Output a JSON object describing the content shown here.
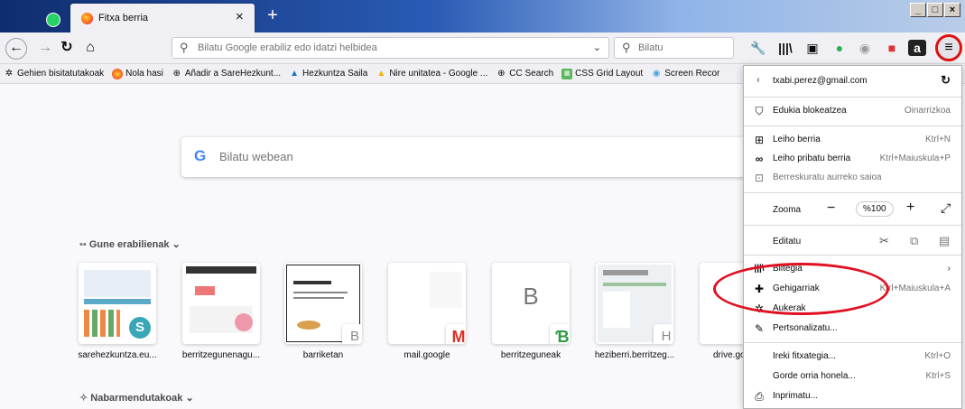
{
  "tabs": {
    "active_title": "Fitxa berria",
    "close_glyph": "×",
    "new_tab_glyph": "+"
  },
  "window_controls": [
    "_",
    "□",
    "×"
  ],
  "nav": {
    "url_placeholder": "Bilatu Google erabiliz edo idatzi helbidea",
    "search_placeholder": "Bilatu"
  },
  "bookmarks": [
    {
      "label": "Gehien bisitatutakoak",
      "icon": "gear-icon",
      "color": "#444"
    },
    {
      "label": "Nola hasi",
      "icon": "firefox-icon",
      "color": "#ff7a1a"
    },
    {
      "label": "Añadir a SareHezkunt...",
      "icon": "globe-icon",
      "color": "#555"
    },
    {
      "label": "Hezkuntza Saila",
      "icon": "hezkuntza-icon",
      "color": "#1a73c8"
    },
    {
      "label": "Nire unitatea - Google ...",
      "icon": "drive-icon",
      "color": "#f4b400"
    },
    {
      "label": "CC Search",
      "icon": "globe-icon",
      "color": "#555"
    },
    {
      "label": "CSS Grid Layout",
      "icon": "css-icon",
      "color": "#5cb85c"
    },
    {
      "label": "Screen Recor",
      "icon": "record-icon",
      "color": "#4aa3df"
    }
  ],
  "newtab": {
    "search_placeholder": "Bilatu webean",
    "top_sites_header": "Gune erabilienak",
    "highlights_header": "Nabarmendutakoak",
    "tiles": [
      {
        "label": "sarehezkuntza.eu...",
        "badge": "S"
      },
      {
        "label": "berritzegunenagu...",
        "badge": ""
      },
      {
        "label": "barriketan",
        "badge": "B"
      },
      {
        "label": "mail.google",
        "badge": "M"
      },
      {
        "label": "berritzeguneak",
        "badge": "B"
      },
      {
        "label": "heziberri.berritzeg...",
        "badge": "H"
      },
      {
        "label": "drive.go",
        "badge": ""
      }
    ]
  },
  "menu": {
    "account": "txabi.perez@gmail.com",
    "content_blocking": "Edukia blokeatzea",
    "content_blocking_value": "Oinarrizkoa",
    "new_window": "Leiho berria",
    "new_window_sc": "Ktrl+N",
    "private_window": "Leiho pribatu berria",
    "private_window_sc": "Ktrl+Maiuskula+P",
    "restore_session": "Berreskuratu aurreko saioa",
    "zoom_label": "Zooma",
    "zoom_value": "%100",
    "edit_label": "Editatu",
    "library": "Biltegia",
    "addons": "Gehigarriak",
    "addons_sc": "Ktrl+Maiuskula+A",
    "options": "Aukerak",
    "customize": "Pertsonalizatu...",
    "open_file": "Ireki fitxategia...",
    "open_file_sc": "Ktrl+O",
    "save_page": "Gorde orria honela...",
    "save_page_sc": "Ktrl+S",
    "print": "Inprimatu..."
  }
}
